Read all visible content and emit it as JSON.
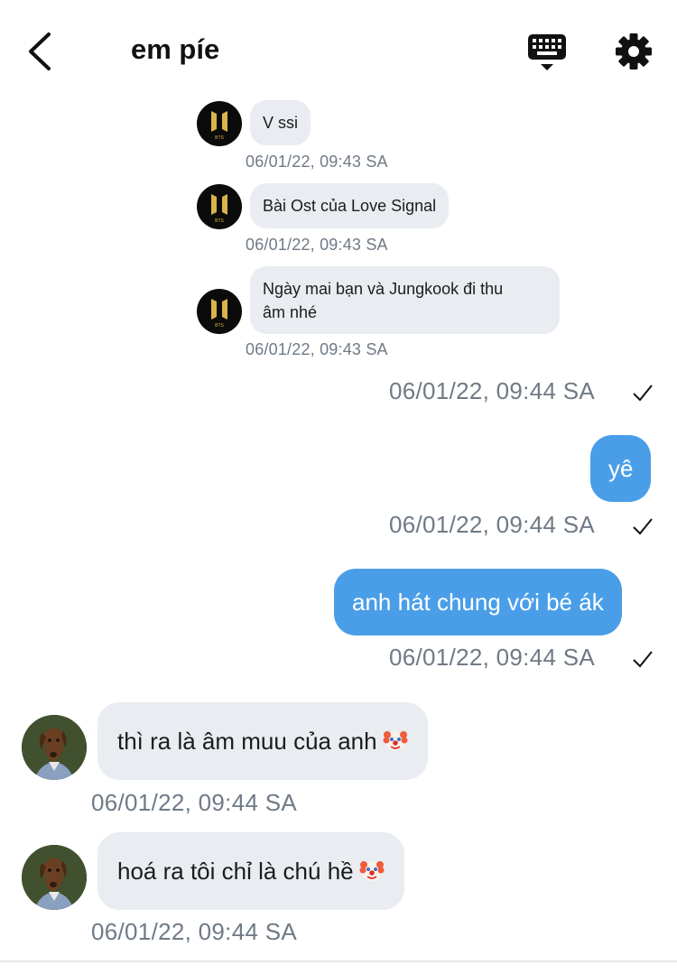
{
  "header": {
    "title": "em píe"
  },
  "messages_bts": [
    {
      "text": "V ssi",
      "time": "06/01/22, 09:43 SA"
    },
    {
      "text": "Bài Ost của Love Signal",
      "time": "06/01/22, 09:43 SA"
    },
    {
      "text": "Ngày mai bạn và Jungkook đi thu âm nhé",
      "line1": "Ngày mai bạn và Jungkook đi thu",
      "line2": "âm nhé",
      "time": "06/01/22, 09:43 SA"
    }
  ],
  "bts_logo_text": "BTS",
  "sent": [
    {
      "time": "06/01/22, 09:44 SA"
    },
    {
      "text": "yê",
      "time": "06/01/22, 09:44 SA"
    },
    {
      "text": "anh hát chung với bé ák",
      "time": "06/01/22, 09:44 SA"
    }
  ],
  "received": [
    {
      "text": "thì ra là âm muu của anh",
      "emoji": "clown-face",
      "time": "06/01/22, 09:44 SA"
    },
    {
      "text": "hoá ra tôi chỉ là chú hề",
      "emoji": "clown-face",
      "time": "06/01/22, 09:44 SA"
    }
  ],
  "colors": {
    "sent_bubble": "#4a9ee8",
    "received_bubble": "#e9ecf1",
    "timestamp": "#6f7a86",
    "bts_logo": "#d8b44a"
  }
}
